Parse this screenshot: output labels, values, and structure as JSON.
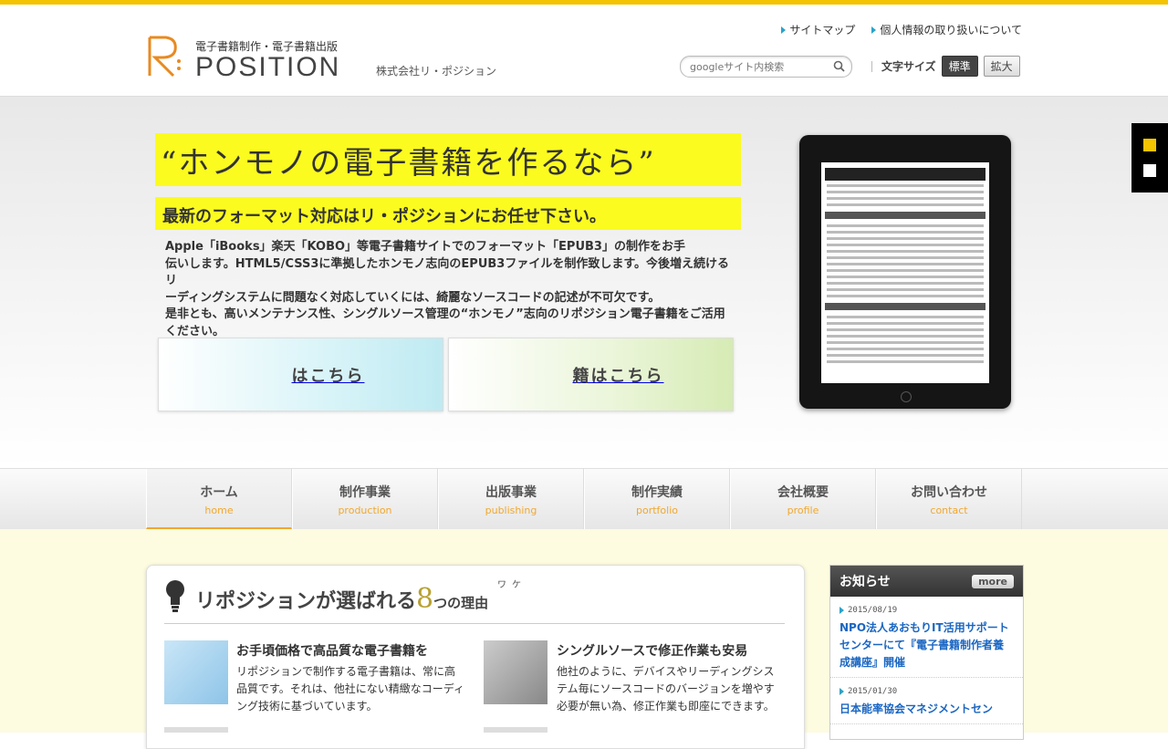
{
  "header": {
    "tagline": "電子書籍制作・電子書籍出版",
    "logo_text": "POSITION",
    "company": "株式会社リ・ポジション",
    "links": [
      "サイトマップ",
      "個人情報の取り扱いについて"
    ],
    "search_placeholder": "googleサイト内検索",
    "font_size_label": "文字サイズ",
    "font_size_options": [
      "標準",
      "拡大"
    ]
  },
  "hero": {
    "quote": "“ホンモノの電子書籍を作るなら”",
    "subtitle": "最新のフォーマット対応はリ・ポジションにお任せ下さい。",
    "body_lines": [
      "Apple「iBooks」楽天「KOBO」等電子書籍サイトでのフォーマット「EPUB3」の制作をお手",
      "伝いします。HTML5/CSS3に準拠したホンモノ志向のEPUB3ファイルを制作致します。今後増え続けるリ",
      "ーディングシステムに問題なく対応していくには、綺麗なソースコードの記述が不可欠です。",
      "是非とも、高いメンテナンス性、シングルソース管理の“ホンモノ”志向のリポジション電子書籍をご活用",
      "ください。"
    ],
    "banner_1": "はこちら",
    "banner_2": "籍はこちら"
  },
  "nav": [
    {
      "jp": "ホーム",
      "en": "home"
    },
    {
      "jp": "制作事業",
      "en": "production"
    },
    {
      "jp": "出版事業",
      "en": "publishing"
    },
    {
      "jp": "制作実績",
      "en": "portfolio"
    },
    {
      "jp": "会社概要",
      "en": "profile"
    },
    {
      "jp": "お問い合わせ",
      "en": "contact"
    }
  ],
  "reasons": {
    "title_a": "リポジションが選ばれる",
    "title_num": "8",
    "title_b": "つの理由",
    "ruby": "ワケ",
    "items": [
      {
        "heading": "お手頃価格で高品質な電子書籍を",
        "body": "リポジションで制作する電子書籍は、常に高品質です。それは、他社にない精緻なコーディング技術に基づいています。"
      },
      {
        "heading": "シングルソースで修正作業も安易",
        "body": "他社のように、デバイスやリーディングシステム毎にソースコードのバージョンを増やす必要が無い為、修正作業も即座にできます。"
      }
    ]
  },
  "news": {
    "title": "お知らせ",
    "more": "more",
    "items": [
      {
        "date": "2015/08/19",
        "text": "NPO法人あおもりIT活用サポートセンターにて『電子書籍制作者養成講座』開催"
      },
      {
        "date": "2015/01/30",
        "text": "日本能率協会マネジメントセン"
      }
    ]
  },
  "colors": {
    "accent": "#f5c400",
    "nav_accent": "#f0a830",
    "highlight": "#fbfb1f",
    "link": "#1a66c2"
  }
}
